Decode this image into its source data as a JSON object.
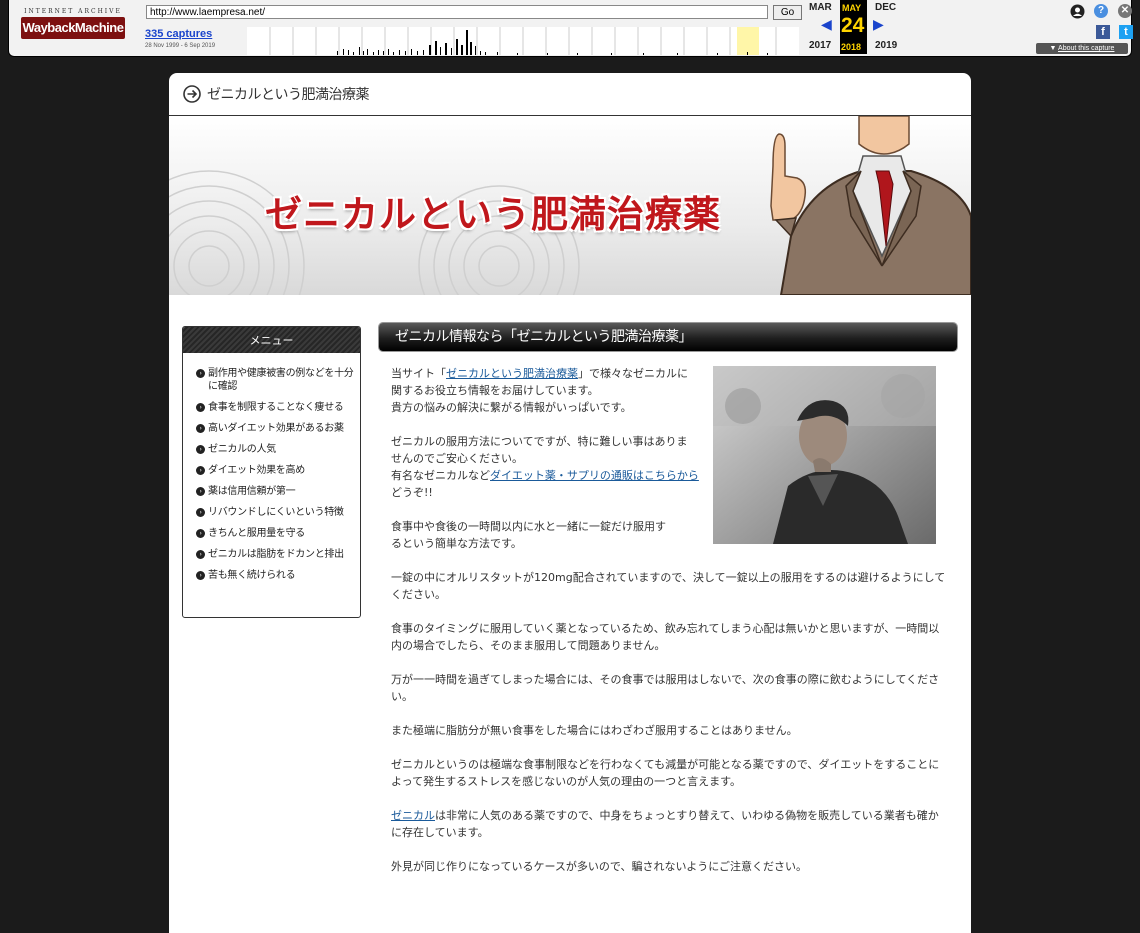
{
  "wayback": {
    "logo_top": "INTERNET ARCHIVE",
    "logo_main": "WaybackMachine",
    "url": "http://www.laempresa.net/",
    "go_label": "Go",
    "captures": "335 captures",
    "range": "28 Nov 1999 - 6 Sep 2019",
    "prev_month": "MAR",
    "cur_month": "MAY",
    "next_month": "DEC",
    "day": "24",
    "prev_year": "2017",
    "cur_year": "2018",
    "next_year": "2019",
    "about": "About this capture",
    "help_glyph": "?",
    "close_glyph": "✕",
    "facebook_glyph": "f",
    "twitter_glyph": "t"
  },
  "header": {
    "title": "ゼニカルという肥満治療薬"
  },
  "banner": {
    "title": "ゼニカルという肥満治療薬"
  },
  "sidebar": {
    "heading": "メニュー",
    "items": [
      {
        "label": "副作用や健康被害の例などを十分に確認"
      },
      {
        "label": "食事を制限することなく痩せる"
      },
      {
        "label": "高いダイエット効果があるお薬"
      },
      {
        "label": "ゼニカルの人気"
      },
      {
        "label": "ダイエット効果を高め"
      },
      {
        "label": "薬は信用信頼が第一"
      },
      {
        "label": "リバウンドしにくいという特徴"
      },
      {
        "label": "きちんと服用量を守る"
      },
      {
        "label": "ゼニカルは脂肪をドカンと排出"
      },
      {
        "label": "苦も無く続けられる"
      }
    ]
  },
  "main": {
    "title": "ゼニカル情報なら「ゼニカルという肥満治療薬」",
    "p1_a": "当サイト「",
    "p1_link": "ゼニカルという肥満治療薬",
    "p1_b": "」で様々なゼニカルに",
    "p1_c": "関するお役立ち情報をお届けしています。",
    "p1_d": "貴方の悩みの解決に繋がる情報がいっぱいです。",
    "p2_a": "ゼニカルの服用方法についてですが、特に難しい事はありま",
    "p2_b": "せんのでご安心ください。",
    "p2_c": "有名なゼニカルなど",
    "p2_link": "ダイエット薬・サプリの通販はこちらから",
    "p2_d": "どうぞ!!",
    "p3_a": "食事中や食後の一時間以内に水と一緒に一錠だけ服用す",
    "p3_b": "るという簡単な方法です。",
    "p4": "一錠の中にオルリスタットが120mg配合されていますので、決して一錠以上の服用をするのは避けるようにしてください。",
    "p5": "食事のタイミングに服用していく薬となっているため、飲み忘れてしまう心配は無いかと思いますが、一時間以内の場合でしたら、そのまま服用して問題ありません。",
    "p6": "万が一一時間を過ぎてしまった場合には、その食事では服用はしないで、次の食事の際に飲むようにしてください。",
    "p7": "また極端に脂肪分が無い食事をした場合にはわざわざ服用することはありません。",
    "p8": "ゼニカルというのは極端な食事制限などを行わなくても減量が可能となる薬ですので、ダイエットをすることによって発生するストレスを感じないのが人気の理由の一つと言えます。",
    "p9_link": "ゼニカル",
    "p9_rest": "は非常に人気のある薬ですので、中身をちょっとすり替えて、いわゆる偽物を販売している業者も確かに存在しています。",
    "p10": "外見が同じ作りになっているケースが多いので、騙されないようにご注意ください。"
  }
}
